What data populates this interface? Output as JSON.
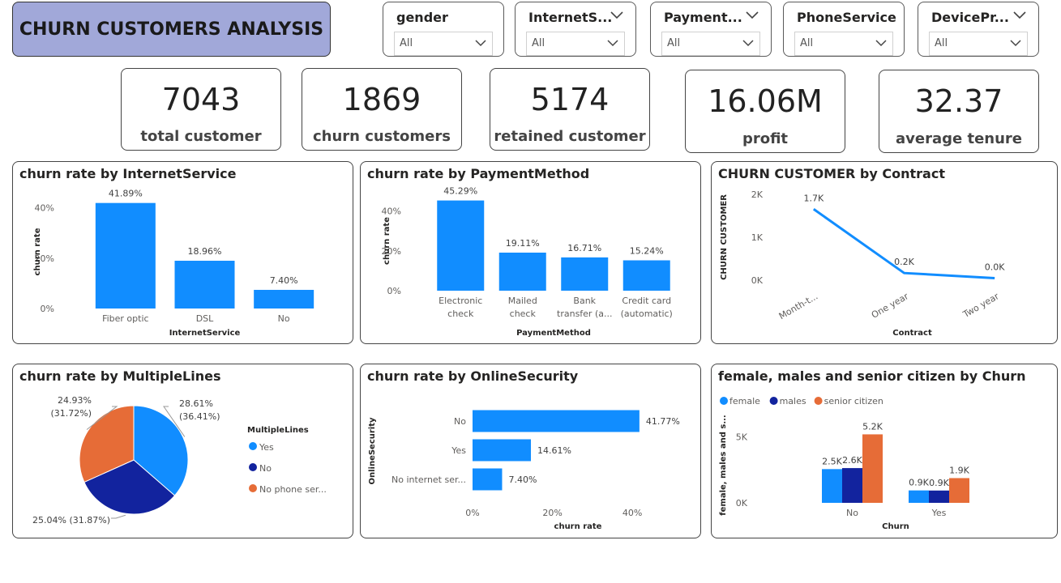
{
  "header": {
    "title": "CHURN CUSTOMERS ANALYSIS"
  },
  "slicers": [
    {
      "label": "gender",
      "value": "All",
      "header_chevron": false
    },
    {
      "label": "InternetS...",
      "value": "All",
      "header_chevron": true
    },
    {
      "label": "Payment...",
      "value": "All",
      "header_chevron": true
    },
    {
      "label": "PhoneService",
      "value": "All",
      "header_chevron": false
    },
    {
      "label": "DevicePr...",
      "value": "All",
      "header_chevron": true
    }
  ],
  "kpis": [
    {
      "value": "7043",
      "label": "total customer"
    },
    {
      "value": "1869",
      "label": "churn customers"
    },
    {
      "value": "5174",
      "label": "retained customer"
    },
    {
      "value": "16.06M",
      "label": "profit"
    },
    {
      "value": "32.37",
      "label": "average tenure"
    }
  ],
  "colors": {
    "blue": "#118dff",
    "navy": "#12239e",
    "orange": "#e66c37",
    "axis": "#605e5c"
  },
  "chart_data": [
    {
      "id": "internet",
      "type": "bar",
      "title": "churn rate by InternetService",
      "xlabel": "InternetService",
      "ylabel": "churn rate",
      "categories": [
        "Fiber optic",
        "DSL",
        "No"
      ],
      "values": [
        41.89,
        18.96,
        7.4
      ],
      "data_labels": [
        "41.89%",
        "18.96%",
        "7.40%"
      ],
      "yticks": [
        "0%",
        "20%",
        "40%"
      ],
      "ylim": [
        0,
        45
      ],
      "grid": false
    },
    {
      "id": "payment",
      "type": "bar",
      "title": "churn rate by PaymentMethod",
      "xlabel": "PaymentMethod",
      "ylabel": "churn rate",
      "categories": [
        [
          "Electronic",
          "check"
        ],
        [
          "Mailed",
          "check"
        ],
        [
          "Bank",
          "transfer (a..."
        ],
        [
          "Credit card",
          "(automatic)"
        ]
      ],
      "values": [
        45.29,
        19.11,
        16.71,
        15.24
      ],
      "data_labels": [
        "45.29%",
        "19.11%",
        "16.71%",
        "15.24%"
      ],
      "yticks": [
        "0%",
        "20%",
        "40%"
      ],
      "ylim": [
        0,
        50
      ],
      "grid": false
    },
    {
      "id": "contract",
      "type": "line",
      "title": "CHURN CUSTOMER by Contract",
      "xlabel": "Contract",
      "ylabel": "CHURN CUSTOMER",
      "categories": [
        "Month-t...",
        "One year",
        "Two year"
      ],
      "values": [
        1655,
        166,
        48
      ],
      "data_labels": [
        "1.7K",
        "0.2K",
        "0.0K"
      ],
      "yticks": [
        "0K",
        "1K",
        "2K"
      ],
      "ylim": [
        0,
        2000
      ],
      "grid": false
    },
    {
      "id": "multiplelines",
      "type": "pie",
      "title": "churn rate by MultipleLines",
      "legend_title": "MultipleLines",
      "legend_position": "right",
      "series": [
        {
          "name": "Yes",
          "value": 28.61,
          "label": [
            "28.61%",
            "(36.41%)"
          ]
        },
        {
          "name": "No",
          "value": 25.04,
          "label": [
            "25.04% (31.87%)"
          ]
        },
        {
          "name": "No phone ser...",
          "value": 24.93,
          "label": [
            "24.93%",
            "(31.72%)"
          ]
        }
      ]
    },
    {
      "id": "security",
      "type": "bar",
      "orientation": "horizontal",
      "title": "churn rate by OnlineSecurity",
      "xlabel": "churn rate",
      "ylabel": "OnlineSecurity",
      "categories": [
        "No",
        "Yes",
        "No internet ser..."
      ],
      "values": [
        41.77,
        14.61,
        7.4
      ],
      "data_labels": [
        "41.77%",
        "14.61%",
        "7.40%"
      ],
      "xticks": [
        "0%",
        "20%",
        "40%"
      ],
      "xlim": [
        0,
        42
      ],
      "grid": false
    },
    {
      "id": "demographics",
      "type": "bar",
      "title": "female, males and senior citizen by Churn",
      "xlabel": "Churn",
      "ylabel": "female, males and s...",
      "legend_position": "top-left",
      "categories": [
        "No",
        "Yes"
      ],
      "series": [
        {
          "name": "female",
          "values": [
            2549,
            939
          ],
          "data_labels": [
            "2.5K",
            "0.9K"
          ]
        },
        {
          "name": "males",
          "values": [
            2625,
            930
          ],
          "data_labels": [
            "2.6K",
            "0.9K"
          ]
        },
        {
          "name": "senior citizen",
          "values": [
            5174,
            1869
          ],
          "data_labels": [
            "5.2K",
            "1.9K"
          ]
        }
      ],
      "yticks": [
        "0K",
        "5K"
      ],
      "ylim": [
        0,
        5200
      ],
      "grid": false
    }
  ]
}
